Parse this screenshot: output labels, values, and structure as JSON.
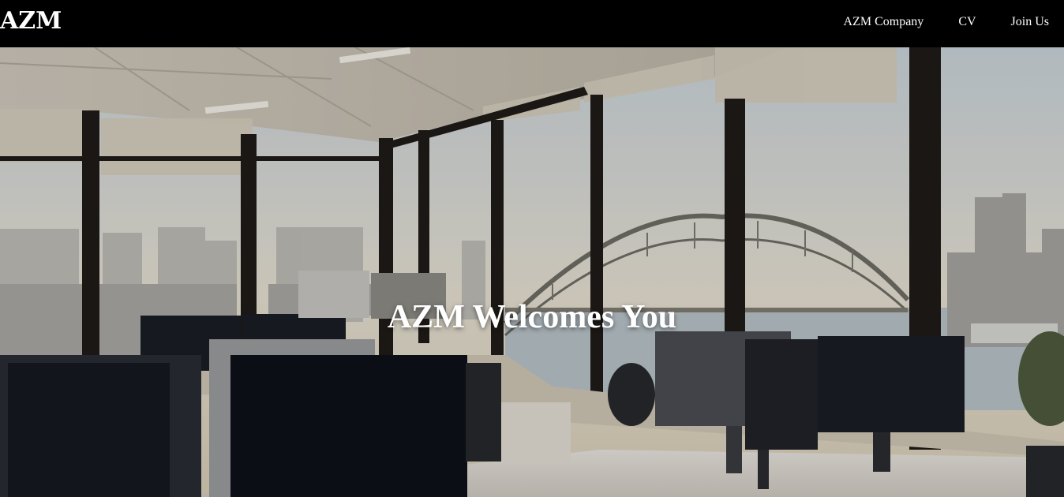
{
  "brand": {
    "logo_text": "AZM"
  },
  "nav": {
    "items": [
      {
        "label": "AZM Company"
      },
      {
        "label": "CV"
      },
      {
        "label": "Join Us"
      }
    ]
  },
  "hero": {
    "title": "AZM Welcomes You",
    "image": "office-harbour-bridge-photo",
    "colors": {
      "sky": "#d9dde0",
      "water": "#b7c4cc",
      "frame": "#2a2520",
      "ceiling": "#d8d4cc"
    }
  }
}
